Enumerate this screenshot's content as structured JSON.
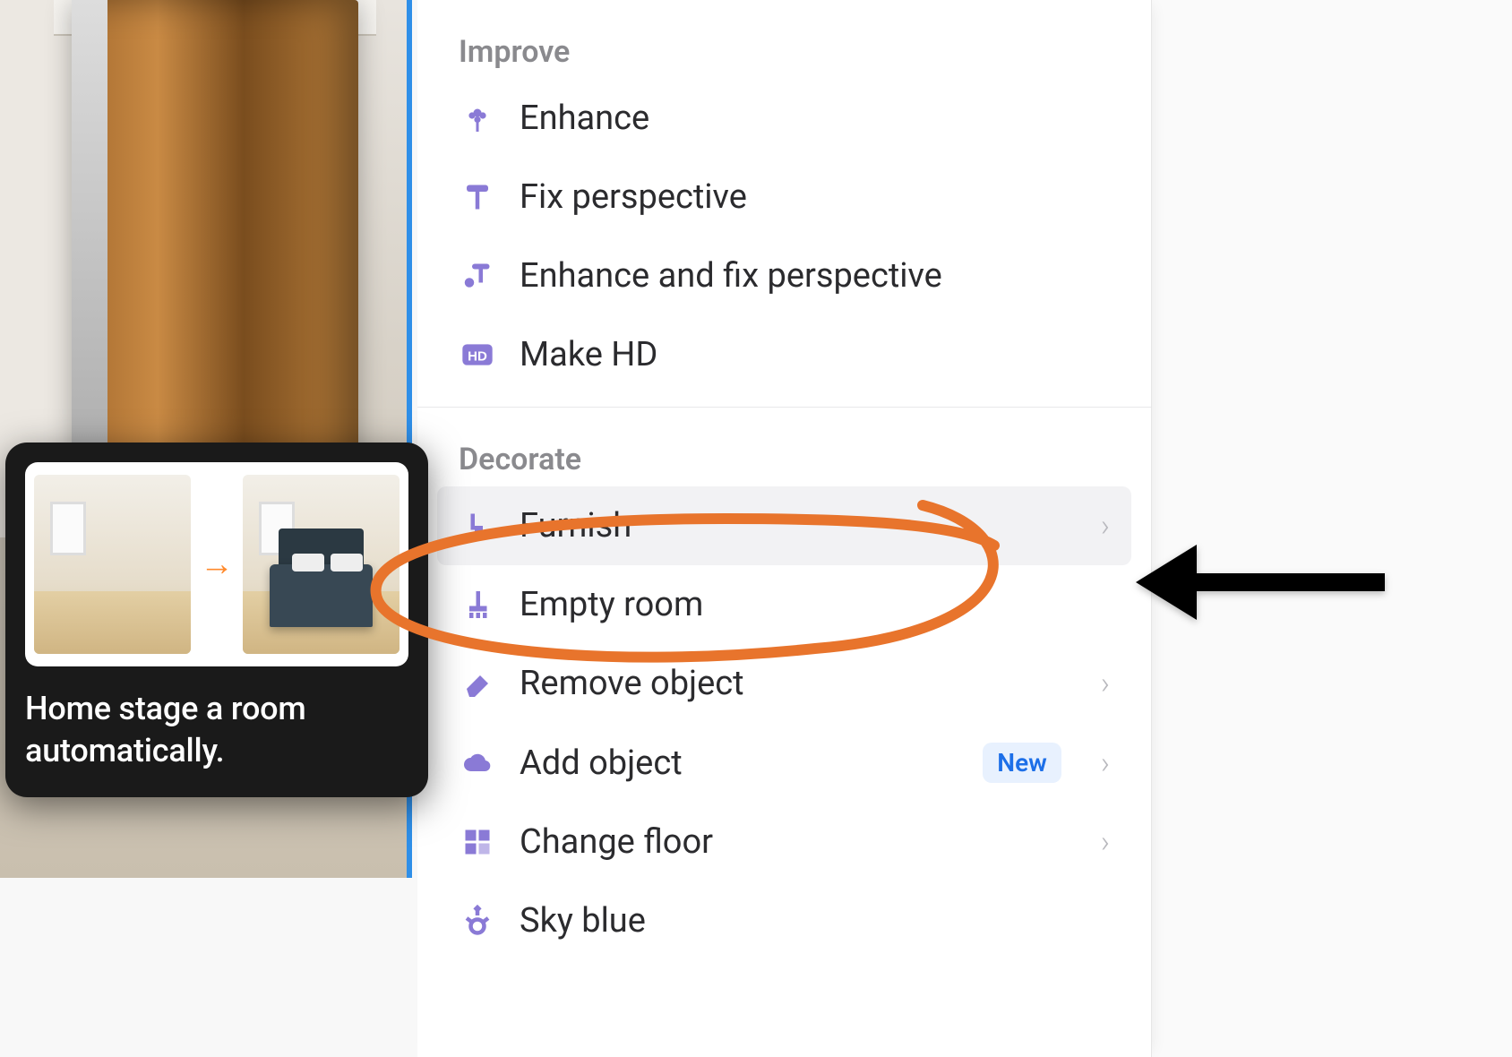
{
  "tooltip": {
    "text": "Home stage a room automatically.",
    "arrow_glyph": "→"
  },
  "sections": {
    "improve": {
      "title": "Improve",
      "items": {
        "enhance": {
          "label": "Enhance"
        },
        "fix_perspective": {
          "label": "Fix perspective"
        },
        "enhance_fix": {
          "label": "Enhance and fix perspective"
        },
        "make_hd": {
          "label": "Make HD"
        }
      }
    },
    "decorate": {
      "title": "Decorate",
      "items": {
        "furnish": {
          "label": "Furnish"
        },
        "empty_room": {
          "label": "Empty room"
        },
        "remove_object": {
          "label": "Remove object"
        },
        "add_object": {
          "label": "Add object",
          "badge": "New"
        },
        "change_floor": {
          "label": "Change floor"
        },
        "sky_blue": {
          "label": "Sky blue"
        }
      }
    }
  },
  "chevron_glyph": "›"
}
